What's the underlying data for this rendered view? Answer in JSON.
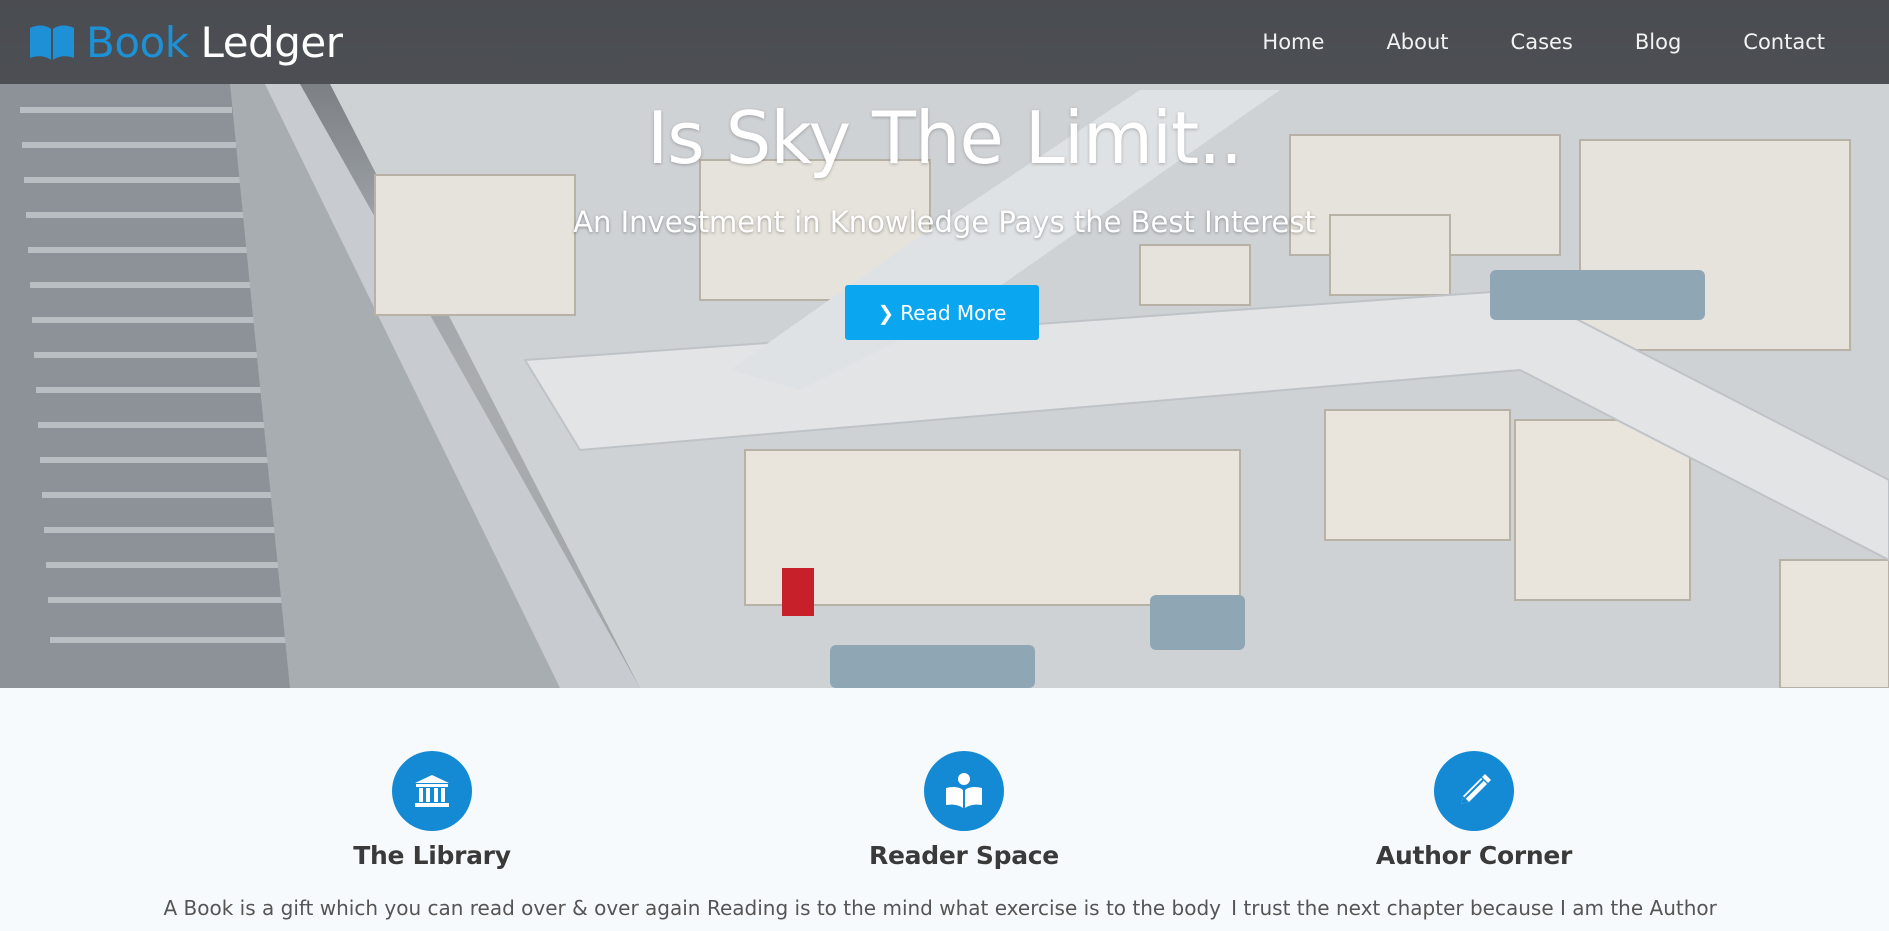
{
  "brand": {
    "part1": "Book",
    "part2": "Ledger",
    "icon": "open-book-icon",
    "accent": "#1e90d6"
  },
  "nav": {
    "items": [
      {
        "label": "Home"
      },
      {
        "label": "About"
      },
      {
        "label": "Cases"
      },
      {
        "label": "Blog"
      },
      {
        "label": "Contact"
      }
    ]
  },
  "hero": {
    "title": "Is Sky The Limit..",
    "subtitle": "An Investment in Knowledge Pays the Best Interest",
    "button_label": "Read More",
    "button_icon": "chevron-right-icon",
    "button_color": "#0aa6f0",
    "background": "library-interior-photo"
  },
  "features": [
    {
      "icon": "institution-icon",
      "title": "The Library",
      "text": "A Book is a gift which you can read over & over again"
    },
    {
      "icon": "reader-icon",
      "title": "Reader Space",
      "text": "Reading is to the mind what exercise is to the body"
    },
    {
      "icon": "pencil-icon",
      "title": "Author Corner",
      "text": "I trust the next chapter because I am the Author"
    }
  ],
  "colors": {
    "feature_icon_bg": "#1489d4",
    "page_bg": "#f7fafc"
  }
}
